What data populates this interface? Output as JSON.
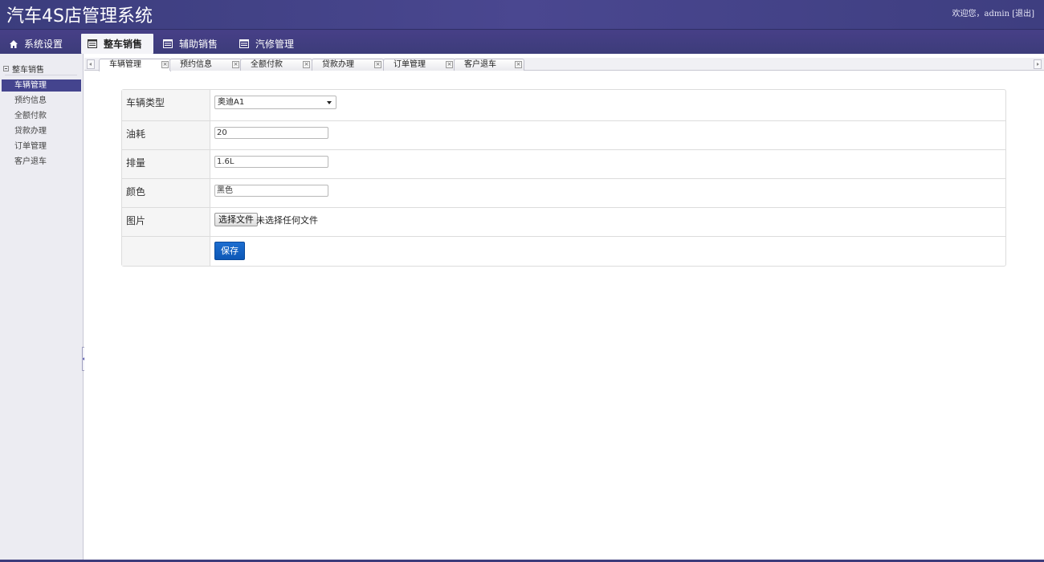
{
  "header": {
    "app_title": "汽车4S店管理系统",
    "welcome": "欢迎您，admin [退出]"
  },
  "nav": {
    "items": [
      {
        "label": "系统设置",
        "icon": "home-icon"
      },
      {
        "label": "整车销售",
        "icon": "list-icon",
        "active": true
      },
      {
        "label": "辅助销售",
        "icon": "list-icon"
      },
      {
        "label": "汽修管理",
        "icon": "list-icon"
      }
    ]
  },
  "sidebar": {
    "heading": "整车销售",
    "items": [
      {
        "label": "车辆管理",
        "active": true
      },
      {
        "label": "预约信息"
      },
      {
        "label": "全额付款"
      },
      {
        "label": "贷款办理"
      },
      {
        "label": "订单管理"
      },
      {
        "label": "客户退车"
      }
    ]
  },
  "tabs": [
    {
      "label": "车辆管理",
      "active": true
    },
    {
      "label": "预约信息"
    },
    {
      "label": "全额付款"
    },
    {
      "label": "贷款办理"
    },
    {
      "label": "订单管理"
    },
    {
      "label": "客户退车"
    }
  ],
  "form": {
    "vehicle_type_label": "车辆类型",
    "vehicle_type_value": "奥迪A1",
    "fuel_label": "油耗",
    "fuel_value": "20",
    "displacement_label": "排量",
    "displacement_value": "1.6L",
    "color_label": "颜色",
    "color_value": "黑色",
    "image_label": "图片",
    "file_button": "选择文件",
    "file_status": "未选择任何文件",
    "save_label": "保存"
  },
  "colors": {
    "header": "#3e3e80",
    "sidebar_active": "#44448e",
    "save_button": "#1466c6"
  }
}
